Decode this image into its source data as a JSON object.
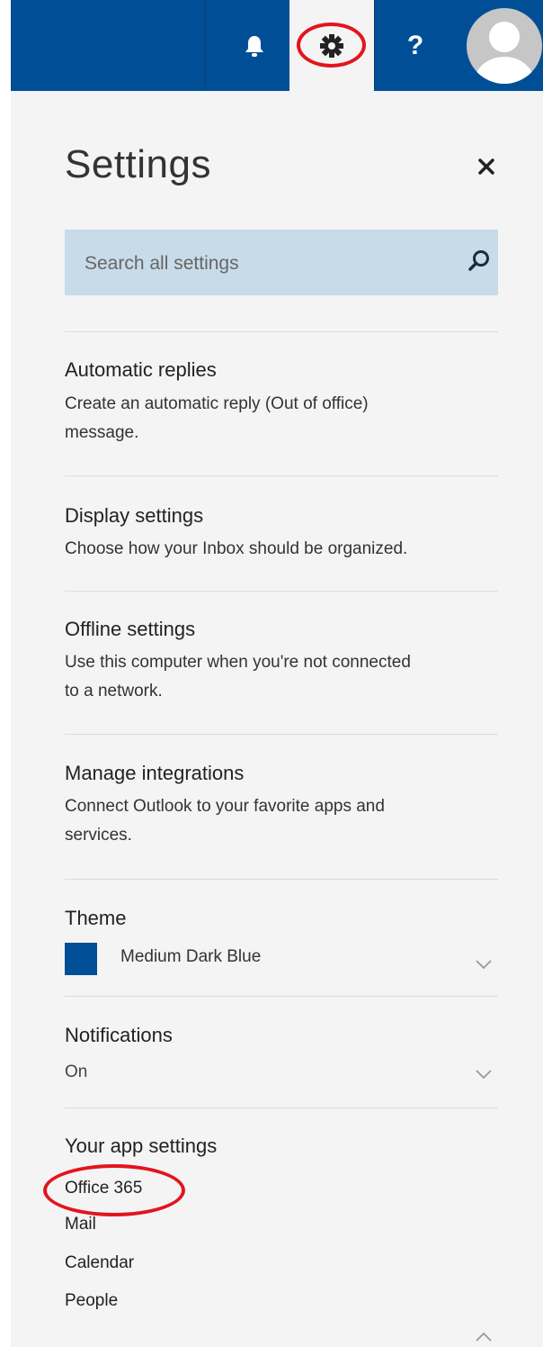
{
  "topbar": {
    "color": "#004f96",
    "icons": [
      "bell-icon",
      "gear-icon",
      "help-icon",
      "avatar"
    ],
    "help_label": "?"
  },
  "settings": {
    "title": "Settings",
    "close_label": "×",
    "search": {
      "placeholder": "Search all settings",
      "value": ""
    },
    "items": [
      {
        "title": "Automatic replies",
        "desc_lines": [
          "Create an automatic reply (Out of office)",
          "message."
        ]
      },
      {
        "title": "Display settings",
        "desc_lines": [
          "Choose how your Inbox should be organized."
        ]
      },
      {
        "title": "Offline settings",
        "desc_lines": [
          "Use this computer when you're not connected",
          "to a network."
        ]
      },
      {
        "title": "Manage integrations",
        "desc_lines": [
          "Connect Outlook to your favorite apps and",
          "services."
        ]
      }
    ],
    "theme": {
      "label": "Theme",
      "value": "Medium Dark Blue",
      "color": "#004f96"
    },
    "notifications": {
      "label": "Notifications",
      "value": "On"
    },
    "app_settings": {
      "label": "Your app settings",
      "links": [
        "Office 365",
        "Mail",
        "Calendar",
        "People"
      ]
    }
  },
  "annotation_color": "#e3141e"
}
